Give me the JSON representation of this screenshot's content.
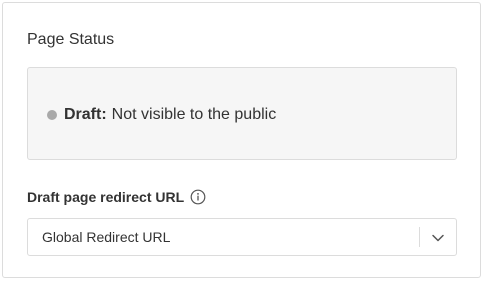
{
  "card": {
    "title": "Page Status"
  },
  "status": {
    "label": "Draft:",
    "text": "Not visible to the public",
    "dot_color": "#a9a9a9"
  },
  "redirect": {
    "label": "Draft page redirect URL",
    "info_icon": "info-circle-icon",
    "selected_value": "Global Redirect URL",
    "dropdown_icon": "chevron-down-icon"
  }
}
